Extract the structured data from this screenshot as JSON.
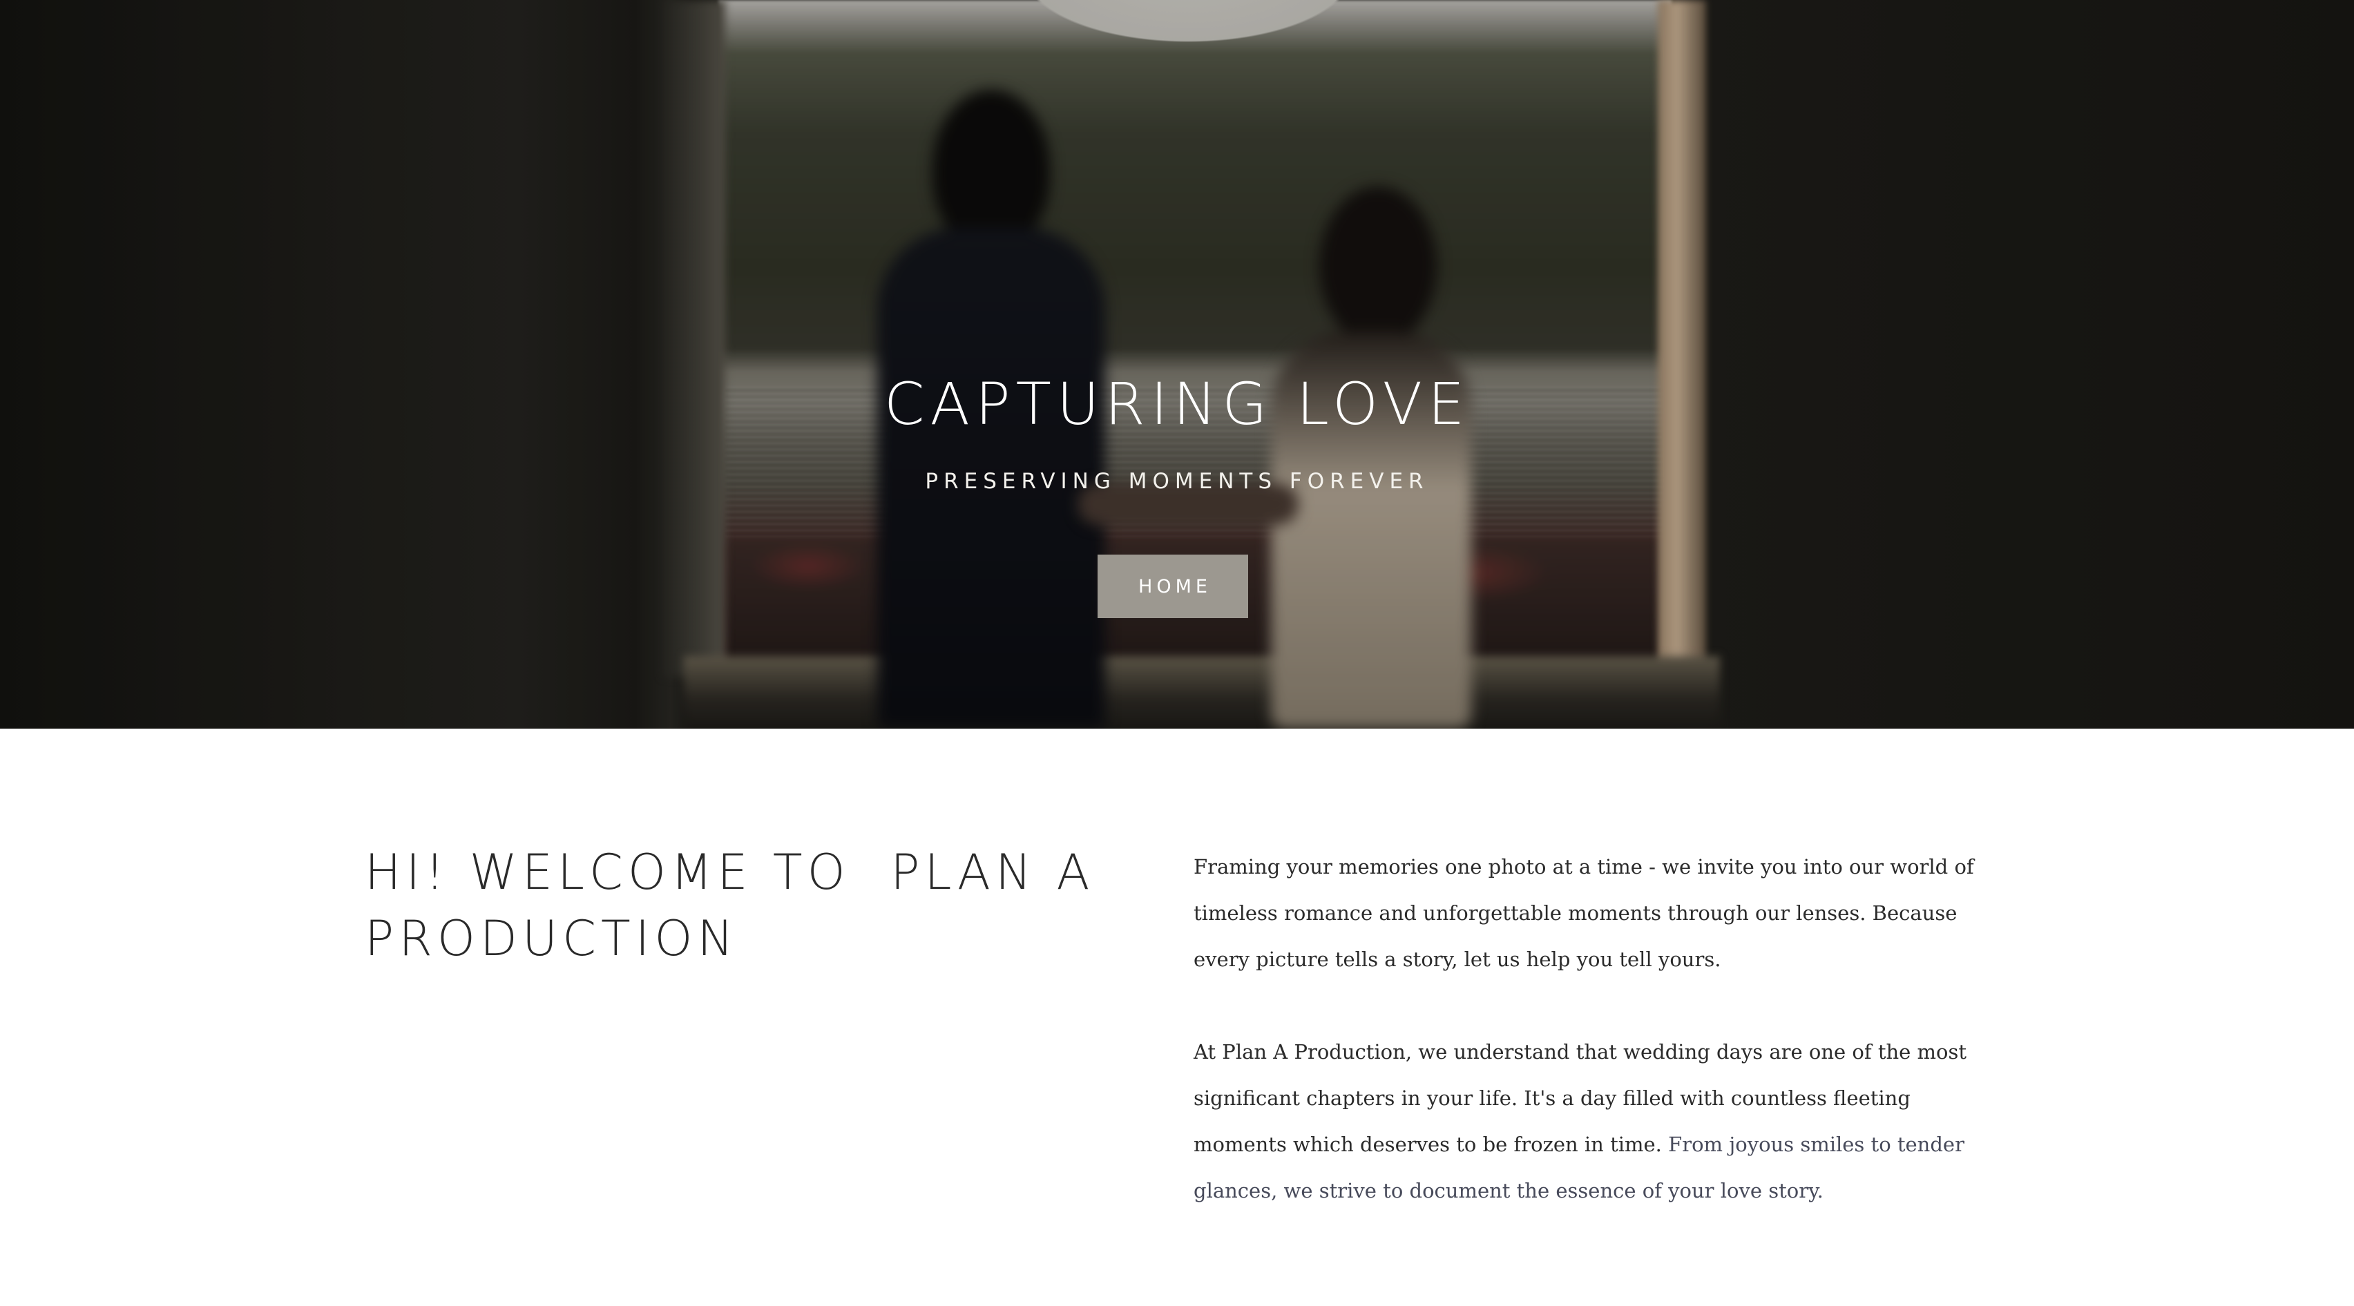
{
  "hero": {
    "title": "CAPTURING LOVE",
    "subtitle": "PRESERVING MOMENTS FOREVER",
    "button_label": "HOME"
  },
  "welcome": {
    "heading_line1": "HI! WELCOME TO  PLAN A",
    "heading_line2": "PRODUCTION",
    "paragraph1": "Framing your memories one photo at a time - we invite you into our world of timeless romance and unforgettable moments through our lenses. Because every picture tells a story, let us help you tell yours.",
    "paragraph2_part1": "At Plan A Production, we understand that wedding days are one of the most significant chapters in your life. It's a day filled with countless fleeting moments which deserves to be frozen in time. ",
    "paragraph2_part2": "From joyous smiles to tender glances, we strive to document the essence of your love story."
  },
  "colors": {
    "button_bg": "#9c9890",
    "heading_text": "#2a2a2a",
    "body_text": "#2b2b2b",
    "muted_text": "#474a5a"
  }
}
